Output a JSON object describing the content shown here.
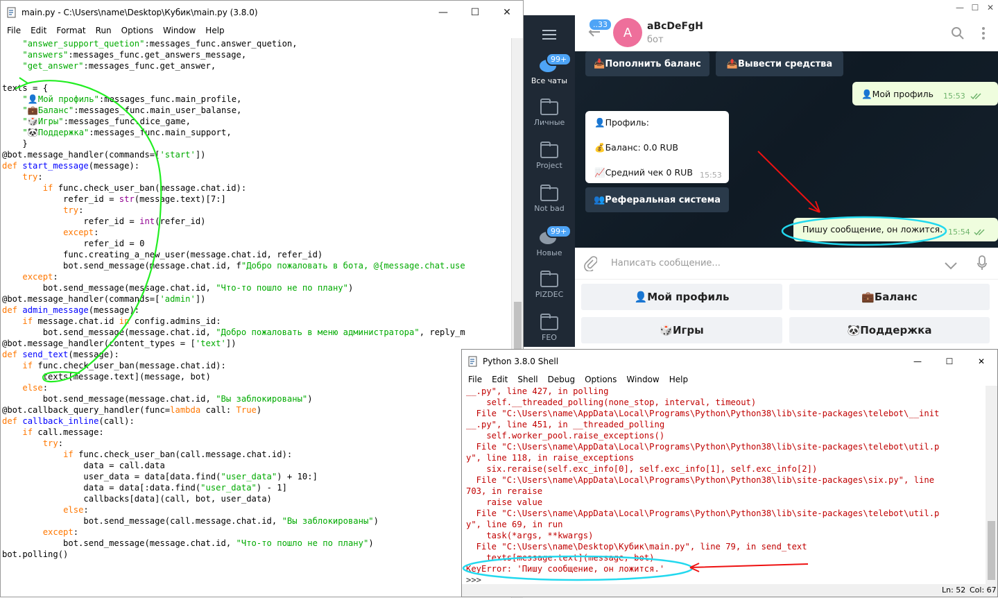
{
  "editor": {
    "title": "main.py - C:\\Users\\name\\Desktop\\Кубик\\main.py (3.8.0)",
    "menu": [
      "File",
      "Edit",
      "Format",
      "Run",
      "Options",
      "Window",
      "Help"
    ],
    "code": [
      [
        [
          "    ",
          ""
        ],
        [
          "\"answer_support_quetion\"",
          "st"
        ],
        [
          ":messages_func.answer_quetion,",
          ""
        ]
      ],
      [
        [
          "    ",
          ""
        ],
        [
          "\"answers\"",
          "st"
        ],
        [
          ":messages_func.get_answers_message,",
          ""
        ]
      ],
      [
        [
          "    ",
          ""
        ],
        [
          "\"get_answer\"",
          "st"
        ],
        [
          ":messages_func.get_answer,",
          ""
        ]
      ],
      [
        [
          "",
          ""
        ]
      ],
      [
        [
          "texts = {",
          ""
        ]
      ],
      [
        [
          "    ",
          ""
        ],
        [
          "\"👤Мой профиль\"",
          "st"
        ],
        [
          ":messages_func.main_profile,",
          ""
        ]
      ],
      [
        [
          "    ",
          ""
        ],
        [
          "\"💼Баланс\"",
          "st"
        ],
        [
          ":messages_func.main_user_balanse,",
          ""
        ]
      ],
      [
        [
          "    ",
          ""
        ],
        [
          "\"🎲Игры\"",
          "st"
        ],
        [
          ":messages_func.dice_game,",
          ""
        ]
      ],
      [
        [
          "    ",
          ""
        ],
        [
          "\"🐼Поддержка\"",
          "st"
        ],
        [
          ":messages_func.main_support,",
          ""
        ]
      ],
      [
        [
          "    }",
          ""
        ]
      ],
      [
        [
          "@bot.message_handler(commands=[",
          ""
        ],
        [
          "'start'",
          "st"
        ],
        [
          "])",
          ""
        ]
      ],
      [
        [
          "def ",
          "kw"
        ],
        [
          "start_message",
          "df"
        ],
        [
          "(message):",
          ""
        ]
      ],
      [
        [
          "    ",
          ""
        ],
        [
          "try",
          "kw"
        ],
        [
          ":",
          ""
        ]
      ],
      [
        [
          "        ",
          ""
        ],
        [
          "if ",
          "kw"
        ],
        [
          "func.check_user_ban(message.chat.id):",
          ""
        ]
      ],
      [
        [
          "            refer_id = ",
          ""
        ],
        [
          "str",
          "bi"
        ],
        [
          "(message.text)[7:]",
          ""
        ]
      ],
      [
        [
          "            ",
          ""
        ],
        [
          "try",
          "kw"
        ],
        [
          ":",
          ""
        ]
      ],
      [
        [
          "                refer_id = ",
          ""
        ],
        [
          "int",
          "bi"
        ],
        [
          "(refer_id)",
          ""
        ]
      ],
      [
        [
          "            ",
          ""
        ],
        [
          "except",
          "kw"
        ],
        [
          ":",
          ""
        ]
      ],
      [
        [
          "                refer_id = 0",
          ""
        ]
      ],
      [
        [
          "            func.creating_a_new_user(message.chat.id, refer_id)",
          ""
        ]
      ],
      [
        [
          "            bot.send_message(message.chat.id, f",
          ""
        ],
        [
          "\"Добро пожаловать в бота, @{message.chat.use",
          "st"
        ]
      ],
      [
        [
          "    ",
          ""
        ],
        [
          "except",
          "kw"
        ],
        [
          ":",
          ""
        ]
      ],
      [
        [
          "        bot.send_message(message.chat.id, ",
          ""
        ],
        [
          "\"Что-то пошло не по плану\"",
          "st"
        ],
        [
          ")",
          ""
        ]
      ],
      [
        [
          "@bot.message_handler(commands=[",
          ""
        ],
        [
          "'admin'",
          "st"
        ],
        [
          "])",
          ""
        ]
      ],
      [
        [
          "def ",
          "kw"
        ],
        [
          "admin_message",
          "df"
        ],
        [
          "(message):",
          ""
        ]
      ],
      [
        [
          "    ",
          ""
        ],
        [
          "if ",
          "kw"
        ],
        [
          "message.chat.id ",
          ""
        ],
        [
          "in ",
          "kw"
        ],
        [
          "config.admins_id:",
          ""
        ]
      ],
      [
        [
          "        bot.send_message(message.chat.id, ",
          ""
        ],
        [
          "\"Добро пожаловать в меню администратора\"",
          "st"
        ],
        [
          ", reply_m",
          ""
        ]
      ],
      [
        [
          "@bot.message_handler(content_types = [",
          ""
        ],
        [
          "'text'",
          "st"
        ],
        [
          "])",
          ""
        ]
      ],
      [
        [
          "def ",
          "kw"
        ],
        [
          "send_text",
          "df"
        ],
        [
          "(message):",
          ""
        ]
      ],
      [
        [
          "    ",
          ""
        ],
        [
          "if ",
          "kw"
        ],
        [
          "func.check_user_ban(message.chat.id):",
          ""
        ]
      ],
      [
        [
          "        texts[message.text](message, bot)",
          ""
        ]
      ],
      [
        [
          "    ",
          ""
        ],
        [
          "else",
          "kw"
        ],
        [
          ":",
          ""
        ]
      ],
      [
        [
          "        bot.send_message(message.chat.id, ",
          ""
        ],
        [
          "\"Вы заблокированы\"",
          "st"
        ],
        [
          ")",
          ""
        ]
      ],
      [
        [
          "@bot.callback_query_handler(func=",
          ""
        ],
        [
          "lambda ",
          "kw"
        ],
        [
          "call: ",
          ""
        ],
        [
          "True",
          "kw"
        ],
        [
          ")",
          ""
        ]
      ],
      [
        [
          "def ",
          "kw"
        ],
        [
          "callback_inline",
          "df"
        ],
        [
          "(call):",
          ""
        ]
      ],
      [
        [
          "    ",
          ""
        ],
        [
          "if ",
          "kw"
        ],
        [
          "call.message:",
          ""
        ]
      ],
      [
        [
          "        ",
          ""
        ],
        [
          "try",
          "kw"
        ],
        [
          ":",
          ""
        ]
      ],
      [
        [
          "            ",
          ""
        ],
        [
          "if ",
          "kw"
        ],
        [
          "func.check_user_ban(call.message.chat.id):",
          ""
        ]
      ],
      [
        [
          "                data = call.data",
          ""
        ]
      ],
      [
        [
          "                user_data = data[data.find(",
          ""
        ],
        [
          "\"user_data\"",
          "st"
        ],
        [
          ") + 10:]",
          ""
        ]
      ],
      [
        [
          "                data = data[:data.find(",
          ""
        ],
        [
          "\"user_data\"",
          "st"
        ],
        [
          ") - 1]",
          ""
        ]
      ],
      [
        [
          "                callbacks[data](call, bot, user_data)",
          ""
        ]
      ],
      [
        [
          "            ",
          ""
        ],
        [
          "else",
          "kw"
        ],
        [
          ":",
          ""
        ]
      ],
      [
        [
          "                bot.send_message(call.message.chat.id, ",
          ""
        ],
        [
          "\"Вы заблокированы\"",
          "st"
        ],
        [
          ")",
          ""
        ]
      ],
      [
        [
          "        ",
          ""
        ],
        [
          "except",
          "kw"
        ],
        [
          ":",
          ""
        ]
      ],
      [
        [
          "            bot.send_message(message.chat.id, ",
          ""
        ],
        [
          "\"Что-то пошло не по плану\"",
          "st"
        ],
        [
          ")",
          ""
        ]
      ],
      [
        [
          "bot.polling()",
          ""
        ]
      ]
    ]
  },
  "telegram": {
    "folders": [
      {
        "label": "Все чаты",
        "badge": "99+"
      },
      {
        "label": "Личные",
        "badge": ""
      },
      {
        "label": "Project",
        "badge": ""
      },
      {
        "label": "Not bad",
        "badge": ""
      },
      {
        "label": "Новые",
        "badge": "99+"
      },
      {
        "label": "PIZDEC",
        "badge": ""
      },
      {
        "label": "FEO",
        "badge": ""
      }
    ],
    "back_badge": "..33",
    "avatar_letter": "A",
    "chat_name": "aBcDeFgH",
    "chat_sub": "бот",
    "inline_top": [
      "📥Пополнить баланс",
      "📤Вывести средства"
    ],
    "msg_profile": "👤Мой профиль",
    "msg_profile_time": "15:53",
    "profile_card": {
      "line1": "👤Профиль:",
      "line2": "💰Баланс: 0.0 RUB",
      "line3": "📈Средний чек 0 RUB",
      "time": "15:53"
    },
    "inline_ref": "👥Реферальная система",
    "msg_last": "Пишу сообщение, он ложится.",
    "msg_last_time": "15:54",
    "input_placeholder": "Написать сообщение...",
    "keyboard": [
      "👤Мой профиль",
      "💼Баланс",
      "🎲Игры",
      "🐼Поддержка"
    ]
  },
  "shell": {
    "title": "Python 3.8.0 Shell",
    "menu": [
      "File",
      "Edit",
      "Shell",
      "Debug",
      "Options",
      "Window",
      "Help"
    ],
    "output": [
      "__.py\", line 427, in polling",
      "    self.__threaded_polling(none_stop, interval, timeout)",
      "  File \"C:\\Users\\name\\AppData\\Local\\Programs\\Python\\Python38\\lib\\site-packages\\telebot\\__init",
      "__.py\", line 451, in __threaded_polling",
      "    self.worker_pool.raise_exceptions()",
      "  File \"C:\\Users\\name\\AppData\\Local\\Programs\\Python\\Python38\\lib\\site-packages\\telebot\\util.p",
      "y\", line 118, in raise_exceptions",
      "    six.reraise(self.exc_info[0], self.exc_info[1], self.exc_info[2])",
      "  File \"C:\\Users\\name\\AppData\\Local\\Programs\\Python\\Python38\\lib\\site-packages\\six.py\", line",
      "703, in reraise",
      "    raise value",
      "  File \"C:\\Users\\name\\AppData\\Local\\Programs\\Python\\Python38\\lib\\site-packages\\telebot\\util.p",
      "y\", line 69, in run",
      "    task(*args, **kwargs)",
      "  File \"C:\\Users\\name\\Desktop\\Кубик\\main.py\", line 79, in send_text",
      "    texts[message.text](message, bot)",
      "KeyError: 'Пишу сообщение, он ложится.'"
    ],
    "prompt": ">>>",
    "status_ln": "Ln: 52",
    "status_col": "Col: 67"
  }
}
